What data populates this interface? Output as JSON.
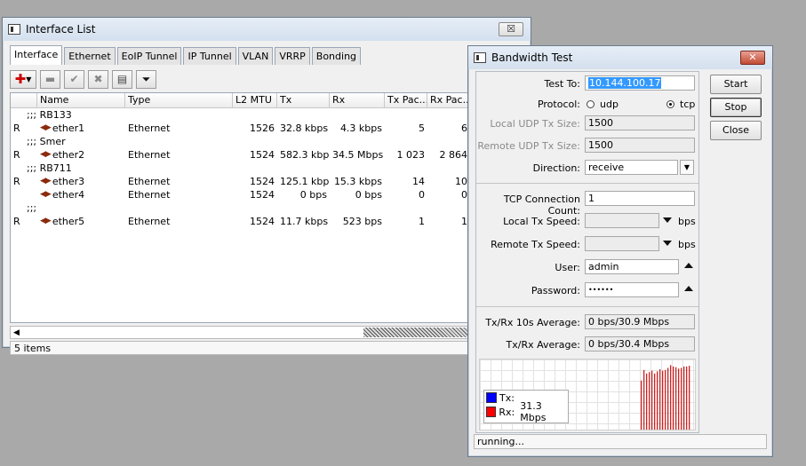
{
  "interface_list": {
    "title": "Interface List",
    "tabs": [
      "Interface",
      "Ethernet",
      "EoIP Tunnel",
      "IP Tunnel",
      "VLAN",
      "VRRP",
      "Bonding"
    ],
    "columns": [
      "",
      "Name",
      "Type",
      "L2 MTU",
      "Tx",
      "Rx",
      "Tx Pac...",
      "Rx Pac..."
    ],
    "rows": [
      {
        "kind": "comment",
        "text": ";;; RB133"
      },
      {
        "kind": "row",
        "flag": "R",
        "name": "ether1",
        "type": "Ethernet",
        "mtu": "1526",
        "tx": "32.8 kbps",
        "rx": "4.3 kbps",
        "txp": "5",
        "rxp": "6"
      },
      {
        "kind": "comment",
        "text": ";;; Smer"
      },
      {
        "kind": "row",
        "flag": "R",
        "name": "ether2",
        "type": "Ethernet",
        "mtu": "1524",
        "tx": "582.3 kbps",
        "rx": "34.5 Mbps",
        "txp": "1 023",
        "rxp": "2 864"
      },
      {
        "kind": "comment",
        "text": ";;; RB711"
      },
      {
        "kind": "row",
        "flag": "R",
        "name": "ether3",
        "type": "Ethernet",
        "mtu": "1524",
        "tx": "125.1 kbps",
        "rx": "15.3 kbps",
        "txp": "14",
        "rxp": "10"
      },
      {
        "kind": "row",
        "flag": "",
        "name": "ether4",
        "type": "Ethernet",
        "mtu": "1524",
        "tx": "0 bps",
        "rx": "0 bps",
        "txp": "0",
        "rxp": "0"
      },
      {
        "kind": "comment",
        "text": ";;;"
      },
      {
        "kind": "row",
        "flag": "R",
        "name": "ether5",
        "type": "Ethernet",
        "mtu": "1524",
        "tx": "11.7 kbps",
        "rx": "523 bps",
        "txp": "1",
        "rxp": "1"
      }
    ],
    "status": "5 items",
    "close_label": "☒"
  },
  "bandwidth_test": {
    "title": "Bandwidth Test",
    "close_label": "✕",
    "labels": {
      "test_to": "Test To:",
      "protocol": "Protocol:",
      "local_udp": "Local UDP Tx Size:",
      "remote_udp": "Remote UDP Tx Size:",
      "direction": "Direction:",
      "tcp_count": "TCP Connection Count:",
      "local_speed": "Local Tx Speed:",
      "remote_speed": "Remote Tx Speed:",
      "user": "User:",
      "password": "Password:",
      "avg10": "Tx/Rx 10s Average:",
      "avg": "Tx/Rx Average:"
    },
    "values": {
      "test_to": "10.144.100.17",
      "protocol_udp": "udp",
      "protocol_tcp": "tcp",
      "protocol_selected": "tcp",
      "local_udp": "1500",
      "remote_udp": "1500",
      "direction": "receive",
      "tcp_count": "1",
      "local_speed": "",
      "remote_speed": "",
      "speed_unit": "bps",
      "user": "admin",
      "password": "••••••",
      "avg10": "0 bps/30.9 Mbps",
      "avg": "0 bps/30.4 Mbps"
    },
    "buttons": {
      "start": "Start",
      "stop": "Stop",
      "close": "Close"
    },
    "legend": {
      "tx_label": "Tx:",
      "tx_value": "",
      "rx_label": "Rx:",
      "rx_value": "31.3 Mbps",
      "tx_color": "#0000ff",
      "rx_color": "#ff0000"
    },
    "status": "running..."
  },
  "chart_data": {
    "type": "bar",
    "series": [
      {
        "name": "Rx",
        "color": "#cc2222",
        "values": [
          0.7,
          0.85,
          0.8,
          0.82,
          0.84,
          0.8,
          0.83,
          0.86,
          0.84,
          0.85,
          0.88,
          0.92,
          0.9,
          0.89,
          0.87,
          0.88,
          0.9,
          0.9,
          0.91
        ]
      },
      {
        "name": "Tx",
        "color": "#0000ff",
        "values": []
      }
    ],
    "grid": true
  }
}
